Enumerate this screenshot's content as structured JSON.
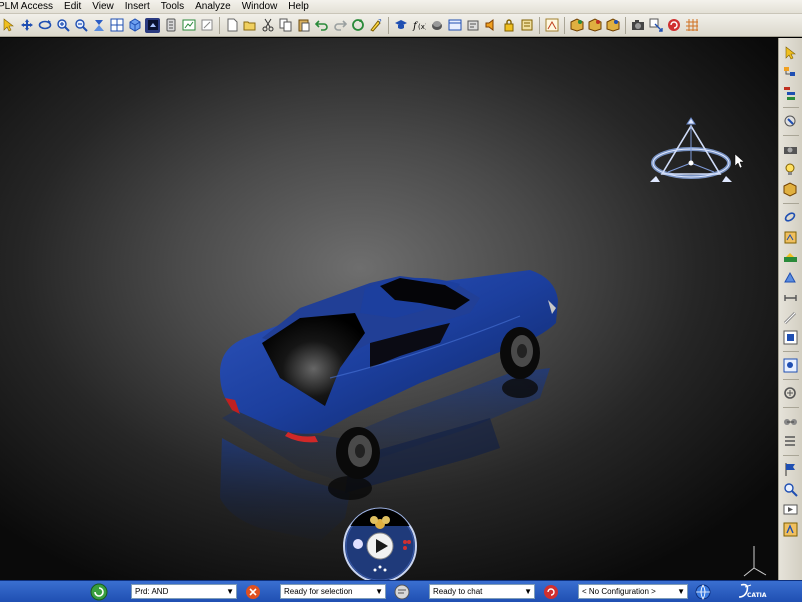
{
  "menu": [
    "PLM Access",
    "Edit",
    "View",
    "Insert",
    "Tools",
    "Analyze",
    "Window",
    "Help"
  ],
  "toolbar_icons": [
    "select-arrow-icon",
    "pan-icon",
    "rotate-icon",
    "zoom-in-icon",
    "zoom-out-icon",
    "normal-view-icon",
    "multi-view-icon",
    "iso-view-icon",
    "render-style-icon",
    "hide-show-icon",
    "swap-space-icon",
    "new-icon",
    "open-icon",
    "cut-icon",
    "copy-icon",
    "paste-icon",
    "undo-icon",
    "redo-icon",
    "update-icon",
    "what-is-this-icon",
    "graduate-icon",
    "formula-icon",
    "knowledge-icon",
    "catalog-icon",
    "law-icon",
    "lock-icon",
    "compass-icon",
    "rule-icon",
    "product-icon",
    "snapshot-icon",
    "cameras-icon",
    "swap-icon",
    "stop-icon",
    "grid-icon"
  ],
  "right_toolbar_icons": [
    "select-icon",
    "tree-icon",
    "spec-tree-icon",
    "scene-icon",
    "camera-icon",
    "light-icon",
    "material-icon",
    "texture-icon",
    "ground-icon",
    "environment-icon",
    "shooting-icon",
    "measure-icon",
    "section-icon",
    "render-icon",
    "turntable-icon",
    "animation-icon",
    "flag-icon",
    "magnifier-icon",
    "video-icon",
    "export-icon"
  ],
  "status": {
    "product_field": "Prd: AND",
    "selection_status": "Ready for selection",
    "chat_status": "Ready to chat",
    "configuration": "< No Configuration >",
    "brand_text": "CATIA"
  },
  "colors": {
    "car_body": "#1c3f9e",
    "statusbar": "#2a5cc4"
  }
}
